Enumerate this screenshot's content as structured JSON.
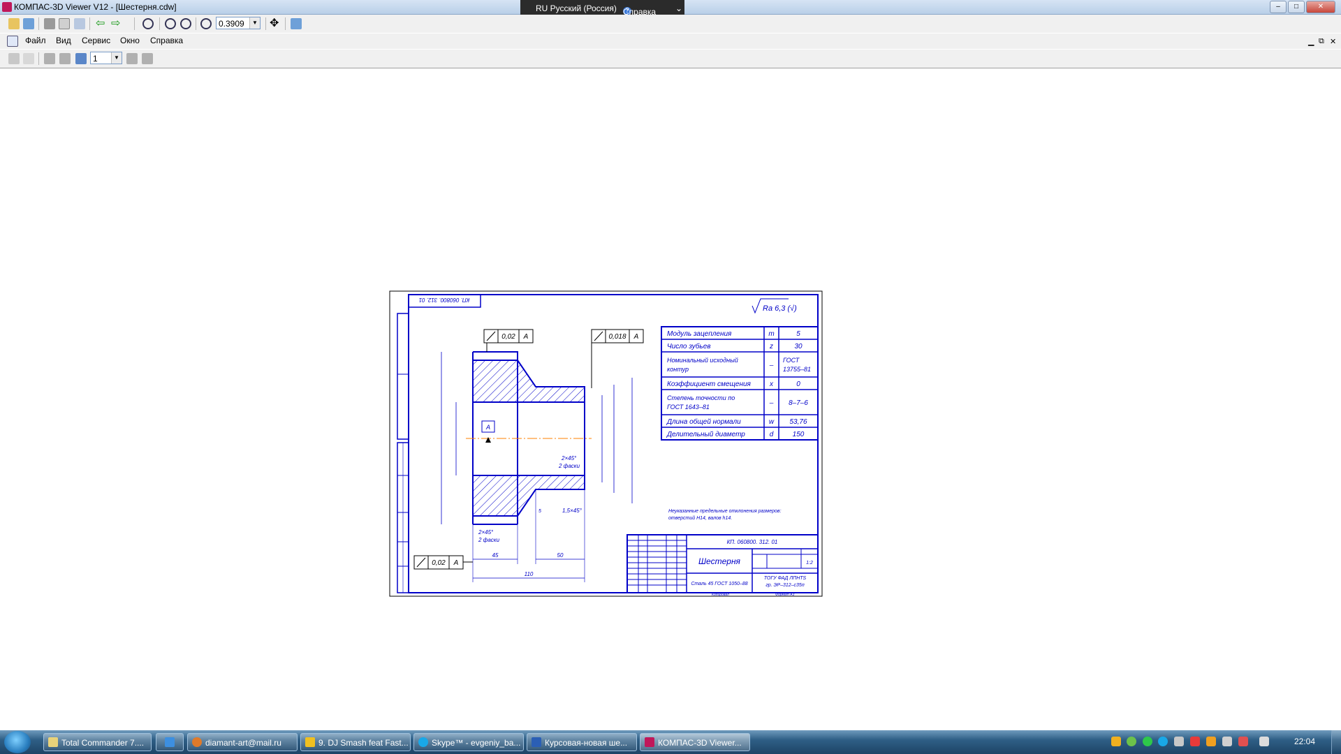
{
  "window": {
    "title": "КОМПАС-3D Viewer V12 - [Шестерня.cdw]",
    "min": "‒",
    "max": "□",
    "close": "✕"
  },
  "langbar": {
    "lang": "RU Русский (Россия)",
    "help": "Справка"
  },
  "toolbar": {
    "zoom_value": "0.3909",
    "page_value": "1"
  },
  "menu": {
    "items": [
      "Файл",
      "Вид",
      "Сервис",
      "Окно",
      "Справка"
    ]
  },
  "colors": {
    "drawing_line": "#0000c8",
    "hatch": "#0000c8",
    "centerline": "#ff8000",
    "titlebar": "#c9daef",
    "taskbar": "#2f5f86"
  },
  "drawing": {
    "doc_code_mirrored": "КП. 060800. 312. 01",
    "roughness": "Ra 6,3 (√)",
    "param_table": [
      {
        "name": "Модуль зацепления",
        "symbol": "m",
        "value": "5"
      },
      {
        "name": "Число зубьев",
        "symbol": "z",
        "value": "30"
      },
      {
        "name": "Номинальный исходный контур",
        "symbol": "–",
        "value": "ГОСТ 13755–81"
      },
      {
        "name": "Коэффициент смещения",
        "symbol": "x",
        "value": "0"
      },
      {
        "name": "Степень точности по ГОСТ 1643–81",
        "symbol": "–",
        "value": "8–7–6"
      },
      {
        "name": "Длина общей нормали",
        "symbol": "w",
        "value": "53,76"
      },
      {
        "name": "Делительный диаметр",
        "symbol": "d",
        "value": "150"
      }
    ],
    "tolerance_top_left": {
      "value": "0,02",
      "base": "A"
    },
    "tolerance_top_right": {
      "value": "0,018",
      "base": "A"
    },
    "tolerance_bottom": {
      "value": "0,02",
      "base": "A"
    },
    "datum": "A",
    "dims": {
      "d45": "45",
      "d50": "50",
      "d110": "110",
      "chamfer1": "2×45°",
      "chamfer1b": "2 фаски",
      "chamfer2": "2×45°",
      "chamfer2b": "2 фаски",
      "chamfer3": "1,5×45°",
      "small5": "5"
    },
    "note": [
      "Неуказанные предельные отклонения размеров:",
      "отверстий H14, валов h14."
    ],
    "title_block": {
      "code": "КП. 060800. 312. 01",
      "name": "Шестерня",
      "material": "Сталь 45 ГОСТ 1050–88",
      "sheet_total": "1:2",
      "org1": "ТОГУ ФАД ЛПНТS",
      "org2": "гр. ЭР–312–с35п",
      "copied": "Копировал",
      "format": "Формат А3"
    }
  },
  "taskbar": {
    "tasks": [
      "Total Commander 7....",
      "",
      "diamant-art@mail.ru",
      "9. DJ Smash feat Fast...",
      "Skype™ - evgeniy_ba...",
      "Курсовая-новая ше...",
      "КОМПАС-3D Viewer..."
    ],
    "clock": "22:04"
  }
}
